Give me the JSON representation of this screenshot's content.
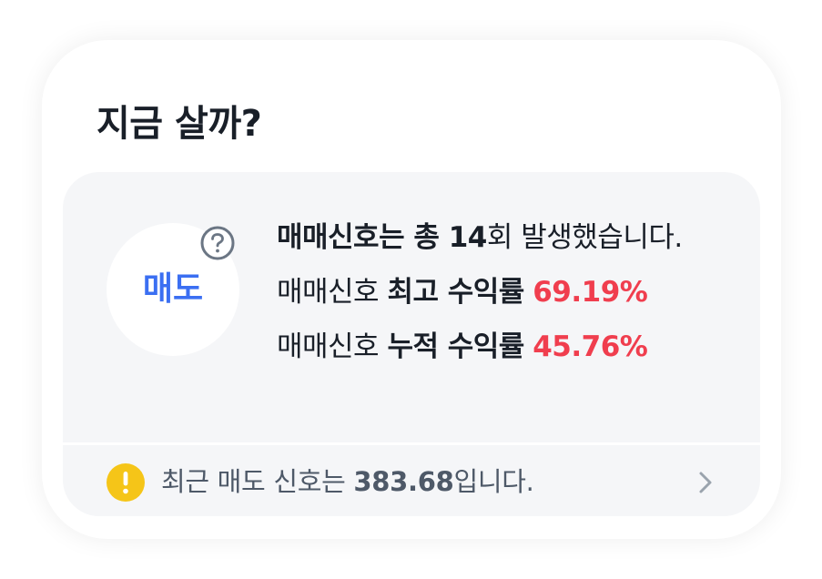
{
  "title": "지금 살까?",
  "signal": {
    "label": "매도",
    "label_color": "#3b6ff2"
  },
  "help_icon": "question-circle-icon",
  "info": {
    "line1_bold": "매매신호는 총 14",
    "line1_rest": "회 발생했습니다.",
    "line2_prefix": "매매신호 ",
    "line2_bold": "최고 수익률",
    "line2_value": "69.19%",
    "line3_prefix": "매매신호 ",
    "line3_bold": "누적 수익률",
    "line3_value": "45.76%",
    "value_color": "#f03e4e"
  },
  "footer": {
    "icon": "warning-icon",
    "text_prefix": "최근 매도 신호는 ",
    "price": "383.68",
    "text_suffix": "입니다.",
    "chevron": "chevron-right-icon"
  }
}
